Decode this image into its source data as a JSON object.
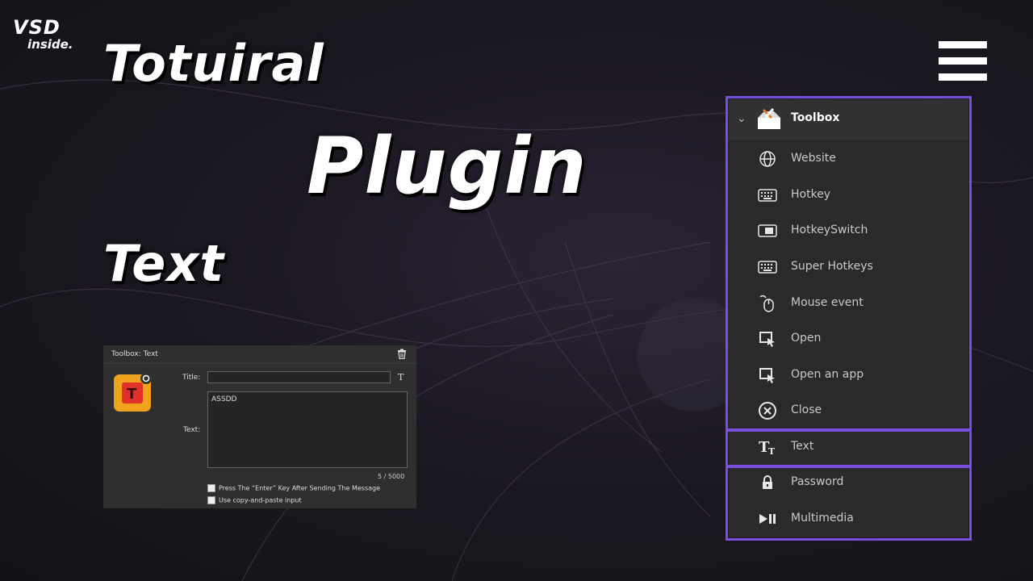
{
  "logo": {
    "brand": "VSD",
    "tagline": "inside."
  },
  "headline": {
    "line1": "Totuiral",
    "line2": "Plugin",
    "line3": "Text"
  },
  "toolbox": {
    "header_label": "Toolbox",
    "items": [
      {
        "label": "Website",
        "icon": "globe-icon"
      },
      {
        "label": "Hotkey",
        "icon": "keyboard-icon"
      },
      {
        "label": "HotkeySwitch",
        "icon": "toggle-icon"
      },
      {
        "label": "Super Hotkeys",
        "icon": "keyboard-icon"
      },
      {
        "label": "Mouse event",
        "icon": "mouse-icon"
      },
      {
        "label": "Open",
        "icon": "cursor-window-icon"
      },
      {
        "label": "Open an app",
        "icon": "cursor-window-icon"
      },
      {
        "label": "Close",
        "icon": "close-circle-icon"
      },
      {
        "label": "Text",
        "icon": "text-icon"
      },
      {
        "label": "Password",
        "icon": "lock-icon"
      },
      {
        "label": "Multimedia",
        "icon": "play-pause-icon"
      }
    ],
    "highlight_color": "#7a4fe0"
  },
  "dialog": {
    "title": "Toolbox: Text",
    "title_label": "Title:",
    "title_value": "",
    "title_type_glyph": "T",
    "text_label": "Text:",
    "text_value": "ASSDD",
    "counter": "5 / 5000",
    "checkbox1_label": "Press The “Enter” Key After Sending The Message",
    "checkbox2_label": "Use copy-and-paste input",
    "app_icon_letter": "T"
  }
}
